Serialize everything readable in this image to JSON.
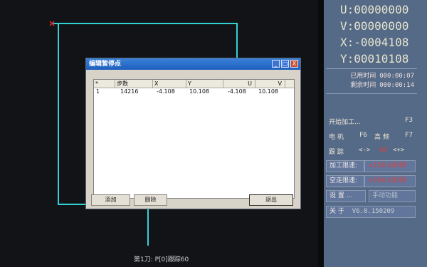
{
  "canvas": {
    "status_text": "第1刀: P[0]跟踪60"
  },
  "coords": {
    "u": "U:00000000",
    "v": "V:00000000",
    "x": "X:-0004108",
    "y": "Y:00010108"
  },
  "times": {
    "used_label": "已用时间",
    "used_value": "000:00:07",
    "remain_label": "剩余时间",
    "remain_value": "000:00:14"
  },
  "panel": {
    "start_label": "开始加工...",
    "start_key": "F3",
    "motor_label": "电 机",
    "motor_key": "F6",
    "high_label": "高 频",
    "high_key": "F7",
    "track_label": "跟 踪",
    "track_minus": "<->",
    "track_value": "60",
    "track_plus": "<+>",
    "feed_label": "加工限速:",
    "feed_value": "<150.0步/秒",
    "idle_label": "空走限速:",
    "idle_value": "<500.0步/秒",
    "settings_label": "设 置 ...",
    "manual_label": "手动功能",
    "about_label": "关 于",
    "version": "V6.0.150209"
  },
  "dialog": {
    "title": "编辑暂停点",
    "min": "_",
    "max": "□",
    "close": "X",
    "columns": [
      "*",
      "步数",
      "X",
      "Y",
      "U",
      "V"
    ],
    "rows": [
      {
        "idx": "1",
        "steps": "14216",
        "x": "-4.108",
        "y": "10.108",
        "u": "-4.108",
        "v": "10.108"
      }
    ],
    "add_label": "添加",
    "delete_label": "删除",
    "exit_label": "退出"
  },
  "colors": {
    "path": "#35d0d6",
    "panel_bg": "#546a86",
    "dialog_title": "#1e5fbe"
  }
}
